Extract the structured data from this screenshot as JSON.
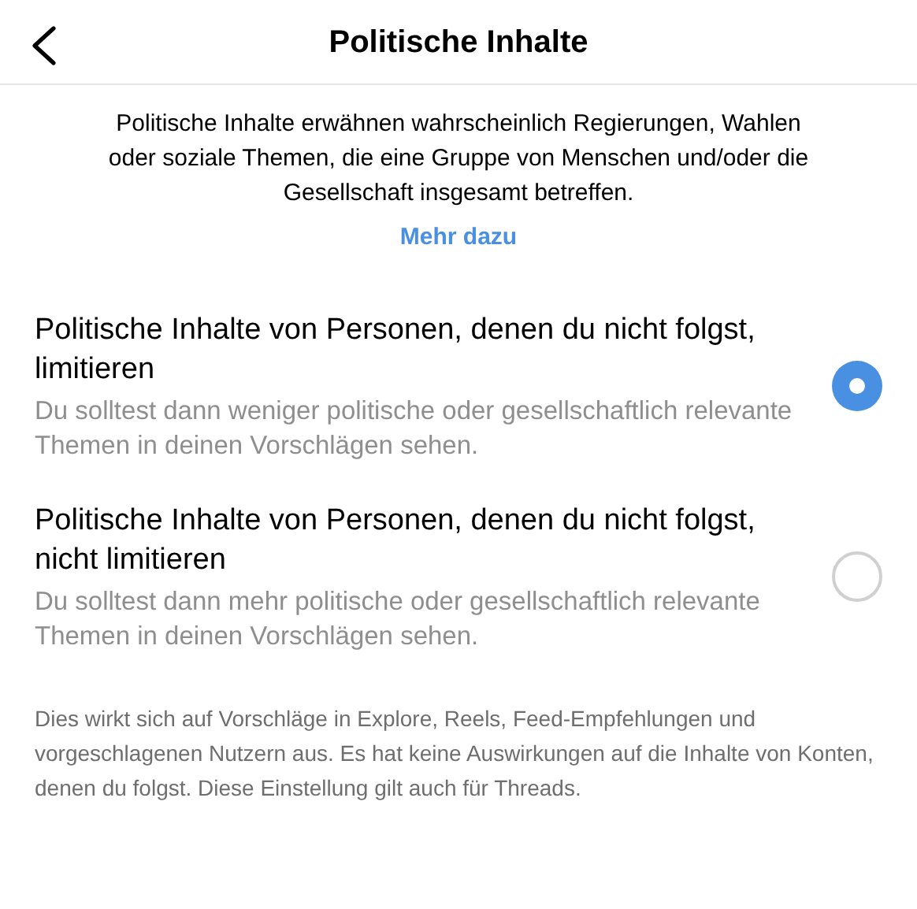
{
  "header": {
    "title": "Politische Inhalte"
  },
  "intro": {
    "text": "Politische Inhalte erwähnen wahrscheinlich Regierungen, Wahlen oder soziale Themen, die eine Gruppe von Menschen und/oder die Gesellschaft insgesamt betreffen.",
    "link": "Mehr dazu"
  },
  "options": [
    {
      "title": "Politische Inhalte von Personen, denen du nicht folgst, limitieren",
      "description": "Du solltest dann weniger politische oder gesellschaftlich relevante Themen in deinen Vorschlägen sehen.",
      "selected": true
    },
    {
      "title": "Politische Inhalte von Personen, denen du nicht folgst, nicht limitieren",
      "description": "Du solltest dann mehr politische oder gesellschaftlich relevante Themen in deinen Vorschlägen sehen.",
      "selected": false
    }
  ],
  "footer": "Dies wirkt sich auf Vorschläge in Explore, Reels, Feed-Empfehlungen und vorgeschlagenen Nutzern aus. Es hat keine Auswirkungen auf die Inhalte von Konten, denen du folgst. Diese Einstellung gilt auch für Threads."
}
